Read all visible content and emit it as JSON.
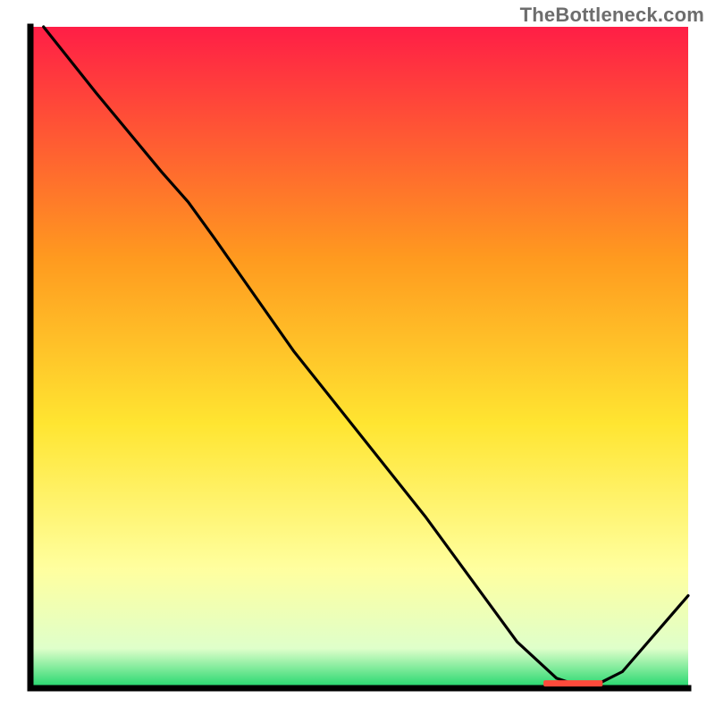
{
  "watermark": "TheBottleneck.com",
  "chart_data": {
    "type": "line",
    "title": "",
    "xlabel": "",
    "ylabel": "",
    "xlim": [
      0,
      100
    ],
    "ylim": [
      0,
      100
    ],
    "series": [
      {
        "name": "curve",
        "x": [
          2,
          10,
          20,
          24,
          28,
          40,
          60,
          74,
          80,
          83,
          86,
          90,
          100
        ],
        "y": [
          100,
          90,
          78,
          73.5,
          68,
          51,
          26,
          7,
          1.5,
          0.5,
          0.5,
          2.5,
          14
        ]
      }
    ],
    "marker_band": {
      "x_start": 78,
      "x_end": 87,
      "y": 0.8
    },
    "colors": {
      "gradient_top": "#ff1e46",
      "gradient_mid_top": "#ff9a1f",
      "gradient_mid": "#ffe531",
      "gradient_lower": "#ffff9f",
      "gradient_near_bottom": "#dfffca",
      "gradient_bottom": "#1fd66b",
      "axis": "#000000",
      "line": "#000000",
      "marker": "#ff4a3b"
    }
  }
}
